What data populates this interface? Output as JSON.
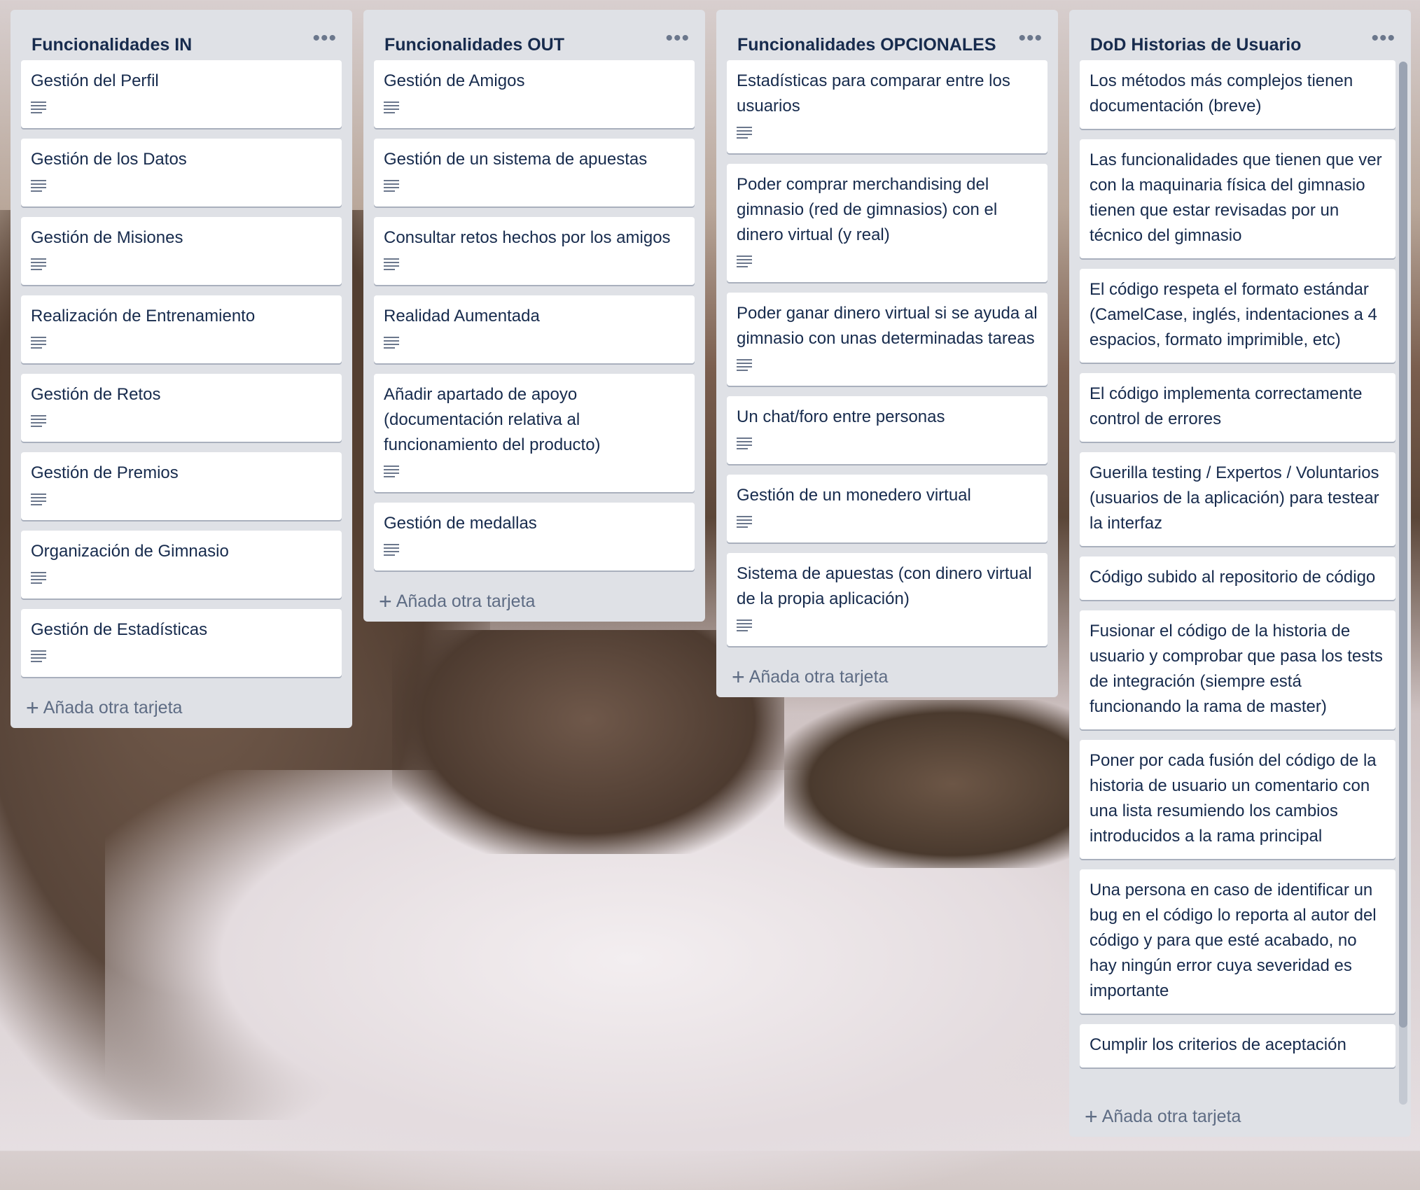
{
  "lists": [
    {
      "title": "Funcionalidades IN",
      "cards": [
        "Gestión del Perfil",
        "Gestión de los Datos",
        "Gestión de Misiones",
        "Realización de Entrenamiento",
        "Gestión de Retos",
        "Gestión de Premios",
        "Organización de Gimnasio",
        "Gestión de Estadísticas"
      ],
      "add_label": "Añada otra tarjeta"
    },
    {
      "title": "Funcionalidades OUT",
      "cards": [
        "Gestión de Amigos",
        "Gestión de un sistema de apuestas",
        "Consultar retos hechos por los amigos",
        "Realidad Aumentada",
        "Añadir apartado de apoyo (documentación relativa al funcionamiento del producto)",
        "Gestión de medallas"
      ],
      "add_label": "Añada otra tarjeta"
    },
    {
      "title": "Funcionalidades OPCIONALES",
      "cards": [
        "Estadísticas para comparar entre los usuarios",
        "Poder comprar merchandising del gimnasio (red de gimnasios) con el dinero virtual (y real)",
        "Poder ganar dinero virtual si se ayuda al gimnasio con unas determinadas tareas",
        "Un chat/foro entre personas",
        "Gestión de un monedero virtual",
        "Sistema de apuestas (con dinero virtual de la propia aplicación)"
      ],
      "add_label": "Añada otra tarjeta"
    },
    {
      "title": "DoD Historias de Usuario",
      "cards": [
        "Los métodos más complejos tienen documentación (breve)",
        "Las funcionalidades que tienen que ver con la maquinaria física del gimnasio tienen que estar revisadas por un técnico del gimnasio",
        "El código respeta el formato estándar (CamelCase, inglés, indentaciones a 4 espacios, formato imprimible, etc)",
        "El código implementa correctamente control de errores",
        "Guerilla testing / Expertos / Voluntarios (usuarios de la aplicación) para testear la interfaz",
        "Código subido al repositorio de código",
        "Fusionar el código de la historia de usuario y comprobar que pasa los tests de integración (siempre está funcionando la rama de master)",
        "Poner por cada fusión del código de la historia de usuario un comentario con una lista resumiendo los cambios introducidos a la rama principal",
        "Una persona en caso de identificar un bug en el código lo reporta al autor del código y para que esté acabado, no hay ningún error cuya severidad es importante",
        "Cumplir los criterios de aceptación"
      ],
      "add_label": "Añada otra tarjeta"
    }
  ],
  "icons": {
    "menu": "more-horizontal-icon",
    "description": "description-lines-icon",
    "add": "plus-icon"
  },
  "colors": {
    "list_bg": "#dfe1e6",
    "card_bg": "#ffffff",
    "title_text": "#172b4d",
    "muted_text": "#5e6c84"
  }
}
